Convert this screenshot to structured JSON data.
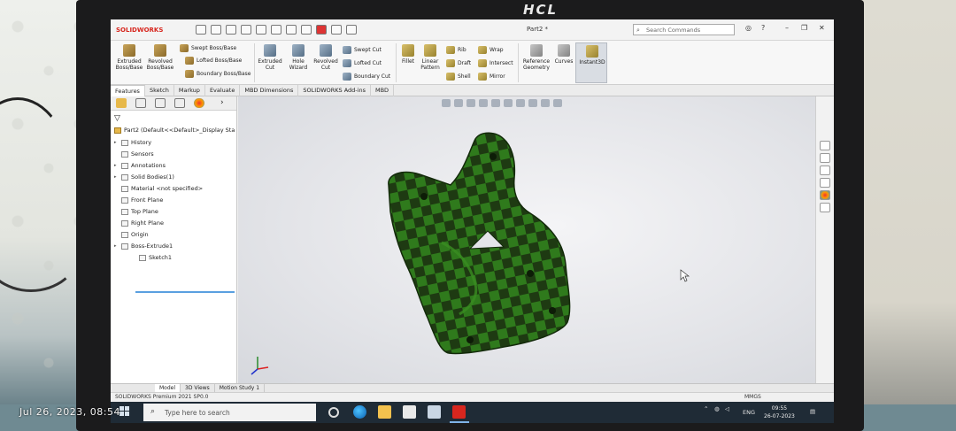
{
  "photo": {
    "monitor_brand": "HCL",
    "timestamp_overlay": "Jul 26, 2023, 08:54"
  },
  "app": {
    "name": "SOLIDWORKS",
    "document_title": "Part2 *",
    "search_placeholder": "Search Commands"
  },
  "ribbon": {
    "extruded_boss": "Extruded Boss/Base",
    "revolved_boss": "Revolved Boss/Base",
    "swept_boss": "Swept Boss/Base",
    "lofted_boss": "Lofted Boss/Base",
    "boundary_boss": "Boundary Boss/Base",
    "extruded_cut": "Extruded Cut",
    "hole_wizard": "Hole Wizard",
    "revolved_cut": "Revolved Cut",
    "swept_cut": "Swept Cut",
    "lofted_cut": "Lofted Cut",
    "boundary_cut": "Boundary Cut",
    "fillet": "Fillet",
    "linear_pattern": "Linear Pattern",
    "rib": "Rib",
    "draft": "Draft",
    "shell": "Shell",
    "wrap": "Wrap",
    "intersect": "Intersect",
    "mirror": "Mirror",
    "reference_geometry": "Reference Geometry",
    "curves": "Curves",
    "instant3d": "Instant3D"
  },
  "command_tabs": [
    "Features",
    "Sketch",
    "Markup",
    "Evaluate",
    "MBD Dimensions",
    "SOLIDWORKS Add-ins",
    "MBD"
  ],
  "feature_tree": {
    "root": "Part2  (Default<<Default>_Display Sta",
    "items": [
      {
        "label": "History",
        "expandable": true
      },
      {
        "label": "Sensors",
        "expandable": false
      },
      {
        "label": "Annotations",
        "expandable": true
      },
      {
        "label": "Solid Bodies(1)",
        "expandable": true
      },
      {
        "label": "Material <not specified>",
        "expandable": false
      },
      {
        "label": "Front Plane",
        "expandable": false
      },
      {
        "label": "Top Plane",
        "expandable": false
      },
      {
        "label": "Right Plane",
        "expandable": false
      },
      {
        "label": "Origin",
        "expandable": false
      },
      {
        "label": "Boss-Extrude1",
        "expandable": true
      },
      {
        "label": "Sketch1",
        "expandable": false
      }
    ]
  },
  "bottom_tabs": [
    "Model",
    "3D Views",
    "Motion Study 1"
  ],
  "status": {
    "product": "SOLIDWORKS Premium 2021 SP0.0",
    "units": "MMGS"
  },
  "taskbar": {
    "search_placeholder": "Type here to search",
    "language": "ENG",
    "time": "09:55",
    "date": "26-07-2023"
  },
  "colors": {
    "model_dark": "#1e3a12",
    "model_light": "#2f7a1c",
    "sw_red": "#d7261e"
  }
}
